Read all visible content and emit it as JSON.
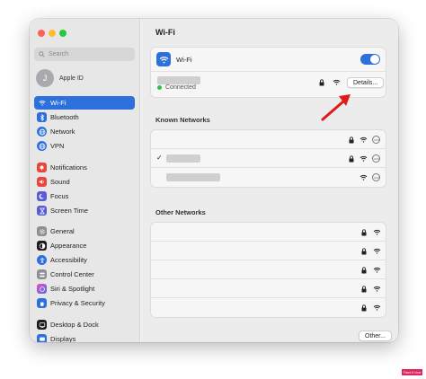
{
  "window": {
    "title": "Wi-Fi"
  },
  "sidebar": {
    "search_placeholder": "Search",
    "apple_id": {
      "initial": "J",
      "label": "Apple ID"
    },
    "items": [
      {
        "label": "Wi-Fi",
        "icon": "wifi-icon",
        "color": "#2d6fdb",
        "selected": true
      },
      {
        "label": "Bluetooth",
        "icon": "bluetooth-icon",
        "color": "#2d6fdb"
      },
      {
        "label": "Network",
        "icon": "globe-icon",
        "color": "#2d6fdb"
      },
      {
        "label": "VPN",
        "icon": "globe-icon",
        "color": "#2d6fdb"
      },
      {
        "label": "Notifications",
        "icon": "bell-icon",
        "color": "#e8453c"
      },
      {
        "label": "Sound",
        "icon": "speaker-icon",
        "color": "#e8453c"
      },
      {
        "label": "Focus",
        "icon": "moon-icon",
        "color": "#5b5bd6"
      },
      {
        "label": "Screen Time",
        "icon": "hourglass-icon",
        "color": "#5b5bd6"
      },
      {
        "label": "General",
        "icon": "gear-icon",
        "color": "#8e8e93"
      },
      {
        "label": "Appearance",
        "icon": "appearance-icon",
        "color": "#1c1c1e"
      },
      {
        "label": "Accessibility",
        "icon": "accessibility-icon",
        "color": "#2d6fdb"
      },
      {
        "label": "Control Center",
        "icon": "control-center-icon",
        "color": "#8e8e93"
      },
      {
        "label": "Siri & Spotlight",
        "icon": "siri-icon",
        "color": "#b14fd8"
      },
      {
        "label": "Privacy & Security",
        "icon": "hand-icon",
        "color": "#2d6fdb"
      },
      {
        "label": "Desktop & Dock",
        "icon": "dock-icon",
        "color": "#1c1c1e"
      },
      {
        "label": "Displays",
        "icon": "display-icon",
        "color": "#2d6fdb"
      }
    ]
  },
  "main": {
    "wifi_row": {
      "label": "Wi-Fi",
      "toggle_on": true
    },
    "connected_row": {
      "status": "Connected",
      "details_button": "Details..."
    },
    "known_networks": {
      "header": "Known Networks",
      "rows": [
        {
          "checked": false,
          "locked": true
        },
        {
          "checked": true,
          "locked": true,
          "check": "✓"
        },
        {
          "checked": false,
          "locked": false
        }
      ]
    },
    "other_networks": {
      "header": "Other Networks",
      "rows": 6,
      "other_button": "Other..."
    }
  },
  "watermark": "Fixed It Now",
  "colors": {
    "accent": "#2d6fdb",
    "arrow": "#e01b1b",
    "connected": "#33c23d"
  }
}
